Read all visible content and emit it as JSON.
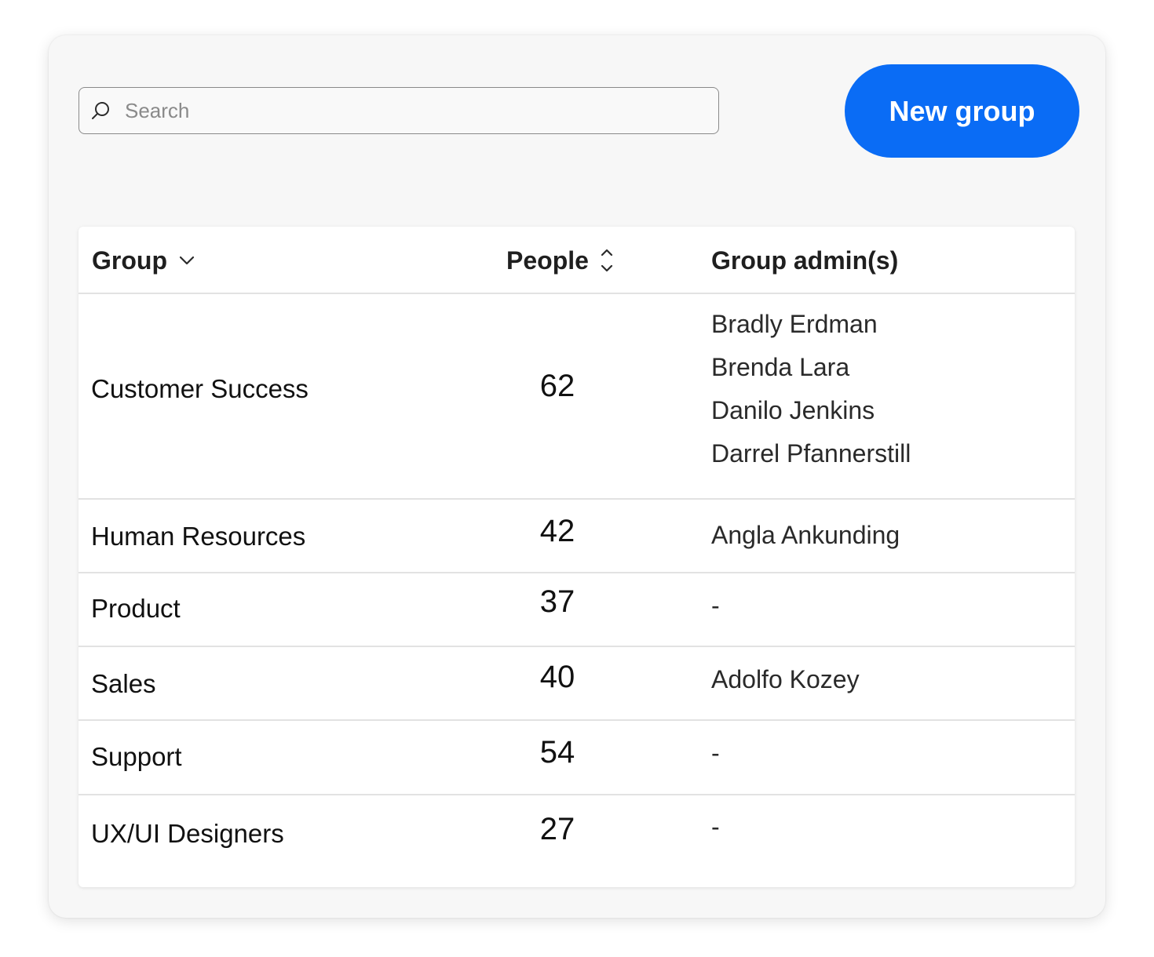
{
  "search": {
    "placeholder": "Search",
    "icon": "search-icon"
  },
  "actions": {
    "new_group_label": "New group",
    "accent_color": "#0a6cf5"
  },
  "table": {
    "columns": {
      "group": {
        "label": "Group",
        "sort_icon": "chevron-down-icon"
      },
      "people": {
        "label": "People",
        "sort_icon": "sort-updown-icon"
      },
      "admins": {
        "label": "Group admin(s)"
      }
    },
    "rows": [
      {
        "group": "Customer Success",
        "people": "62",
        "admins": [
          "Bradly Erdman",
          "Brenda Lara",
          "Danilo Jenkins",
          "Darrel Pfannerstill"
        ]
      },
      {
        "group": "Human Resources",
        "people": "42",
        "admins": [
          "Angla Ankunding"
        ]
      },
      {
        "group": "Product",
        "people": "37",
        "admins": [
          "-"
        ]
      },
      {
        "group": "Sales",
        "people": "40",
        "admins": [
          "Adolfo Kozey"
        ]
      },
      {
        "group": "Support",
        "people": "54",
        "admins": [
          "-"
        ]
      },
      {
        "group": "UX/UI Designers",
        "people": "27",
        "admins": [
          "-"
        ]
      }
    ]
  }
}
